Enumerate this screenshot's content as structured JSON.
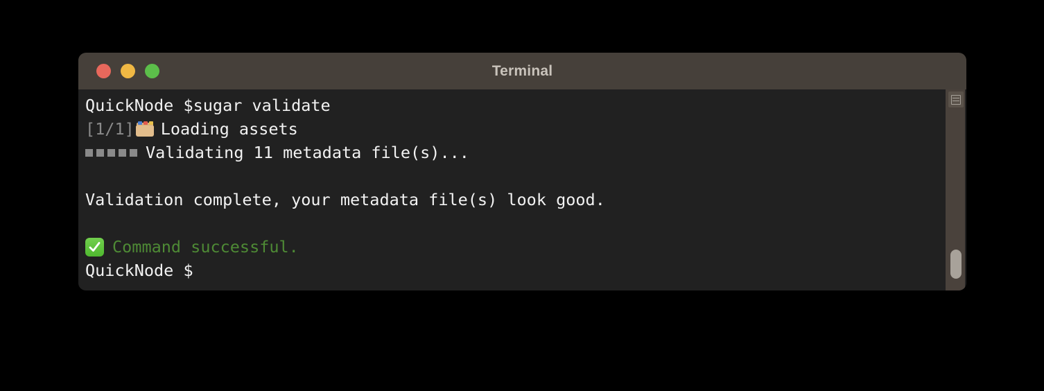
{
  "window": {
    "title": "Terminal",
    "traffic_lights": [
      {
        "name": "close",
        "color": "#e8685c"
      },
      {
        "name": "minimize",
        "color": "#f0b844"
      },
      {
        "name": "zoom",
        "color": "#5cbe4a"
      }
    ]
  },
  "terminal": {
    "prompt_host": "QuickNode",
    "prompt_symbol": "$",
    "lines": {
      "command": "QuickNode $sugar validate",
      "step_counter": "[1/1]",
      "step_label": "Loading assets",
      "progress_label": "Validating 11 metadata file(s)...",
      "progress_squares": 5,
      "result": "Validation complete, your metadata file(s) look good.",
      "success": "Command successful.",
      "final_prompt": "QuickNode $"
    }
  },
  "scrollbar": {
    "button_icon": "lines-icon",
    "thumb_position_percent": 80
  },
  "colors": {
    "titlebar": "#46403a",
    "body": "#212121",
    "text": "#f2f2f2",
    "dim_text": "#8a8a8a",
    "success_green": "#4e8a35",
    "scrollbar_track": "#4a423c",
    "scrollbar_thumb": "#a8a29a"
  }
}
